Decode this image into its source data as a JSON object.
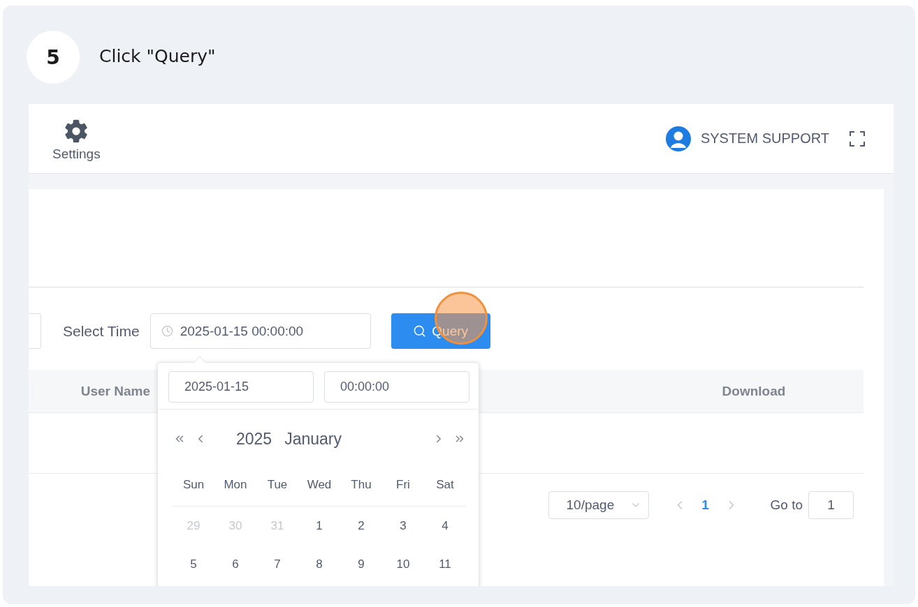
{
  "step": {
    "number": "5",
    "instruction": "Click \"Query\""
  },
  "topbar": {
    "settings_label": "Settings",
    "user": "SYSTEM SUPPORT"
  },
  "filter": {
    "label": "Select Time",
    "value": "2025-01-15 00:00:00",
    "button": "Query"
  },
  "table": {
    "columns": [
      {
        "label": "User Name"
      },
      {
        "label": "Download"
      }
    ]
  },
  "pagination": {
    "page_size": "10/page",
    "pages": [
      {
        "label": "1",
        "selected": true
      }
    ],
    "goto_label": "Go to",
    "goto_value": "1"
  },
  "datepicker": {
    "date": "2025-01-15",
    "time": "00:00:00",
    "year": "2025",
    "month": "January",
    "weekdays": [
      "Sun",
      "Mon",
      "Tue",
      "Wed",
      "Thu",
      "Fri",
      "Sat"
    ],
    "days": [
      {
        "label": "29",
        "outside": true
      },
      {
        "label": "30",
        "outside": true
      },
      {
        "label": "31",
        "outside": true
      },
      {
        "label": "1",
        "outside": false
      },
      {
        "label": "2",
        "outside": false
      },
      {
        "label": "3",
        "outside": false
      },
      {
        "label": "4",
        "outside": false
      },
      {
        "label": "5",
        "outside": false
      },
      {
        "label": "6",
        "outside": false
      },
      {
        "label": "7",
        "outside": false
      },
      {
        "label": "8",
        "outside": false
      },
      {
        "label": "9",
        "outside": false
      },
      {
        "label": "10",
        "outside": false
      },
      {
        "label": "11",
        "outside": false
      }
    ]
  }
}
